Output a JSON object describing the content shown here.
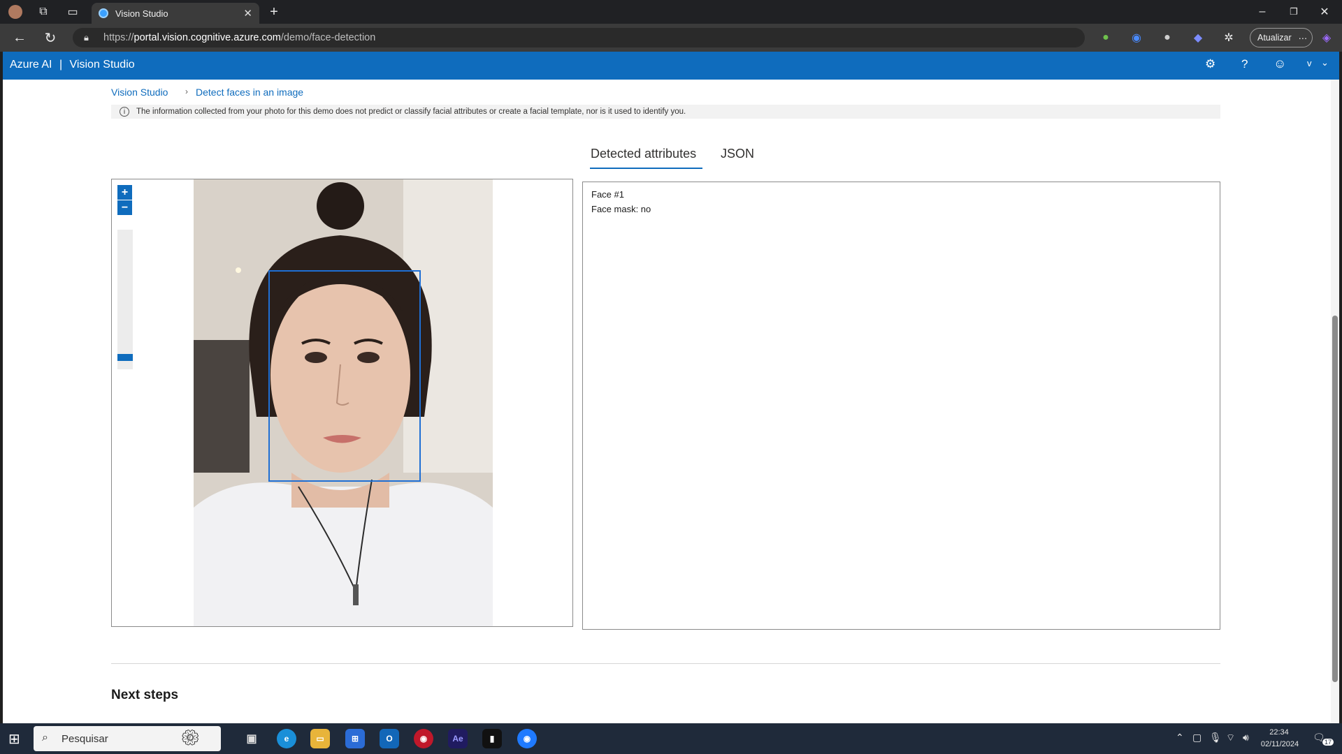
{
  "browser": {
    "tab_title": "Vision Studio",
    "url_prefix": "https://",
    "url_host": "portal.vision.cognitive.azure.com",
    "url_path": "/demo/face-detection",
    "update_button": "Atualizar",
    "new_tab_icon": "+"
  },
  "app": {
    "brand_left": "Azure AI",
    "brand_sep": "|",
    "brand_right": "Vision Studio",
    "user_initial": "v"
  },
  "breadcrumb": {
    "home": "Vision Studio",
    "separator": ">",
    "current": "Detect faces in an image"
  },
  "info": {
    "icon": "i",
    "text": "The information collected from your photo for this demo does not predict or classify facial attributes or create a facial template, nor is it used to identify you."
  },
  "tabs": {
    "attributes": "Detected attributes",
    "json": "JSON"
  },
  "zoom": {
    "in": "+",
    "out": "−"
  },
  "results": {
    "face_title": "Face #1",
    "face_mask": "Face mask: no"
  },
  "next_steps": "Next steps",
  "taskbar": {
    "search_placeholder": "Pesquisar",
    "time": "22:34",
    "date": "02/11/2024",
    "notification_count": "17"
  },
  "colors": {
    "accent": "#0f6cbd",
    "face_box": "#1f6fd4"
  }
}
